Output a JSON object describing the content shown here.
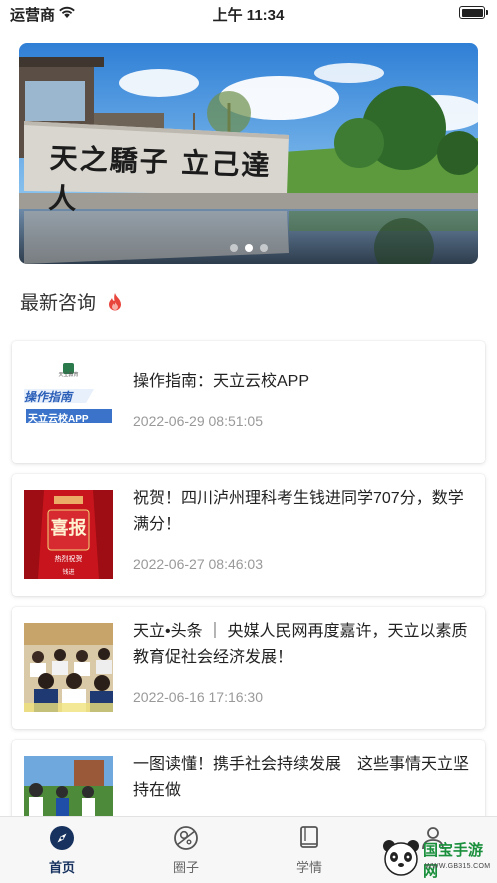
{
  "status": {
    "carrier": "运营商",
    "time": "上午 11:34"
  },
  "banner": {
    "stone_text": "天之驕子 立己達人",
    "dots": 3,
    "active_dot": 1
  },
  "section": {
    "title": "最新咨询"
  },
  "news": [
    {
      "title": "操作指南：天立云校APP",
      "date": "2022-06-29 08:51:05",
      "thumb": {
        "line1": "操作指南",
        "line2": "天立云校APP",
        "brand": "天立教育"
      }
    },
    {
      "title": "祝贺！四川泸州理科考生钱进同学707分，数学满分！",
      "date": "2022-06-27 08:46:03",
      "thumb": {
        "big": "喜报",
        "small": "热烈祝贺",
        "name": "钱进"
      }
    },
    {
      "title": "天立•头条 ｜ 央媒人民网再度嘉许，天立以素质教育促社会经济发展！",
      "date": "2022-06-16 17:16:30"
    },
    {
      "title": "一图读懂！携手社会持续发展　这些事情天立坚持在做",
      "date": ""
    }
  ],
  "tabs": [
    {
      "label": "首页",
      "icon": "compass-icon"
    },
    {
      "label": "圈子",
      "icon": "planet-icon"
    },
    {
      "label": "学情",
      "icon": "book-icon"
    },
    {
      "label": "",
      "icon": "person-icon"
    }
  ],
  "watermark": {
    "name": "国宝手游网",
    "url": "WWW.GB315.COM"
  },
  "colors": {
    "accent": "#17325e",
    "flame": "#e8453c",
    "watermark": "#1a8f3c"
  }
}
